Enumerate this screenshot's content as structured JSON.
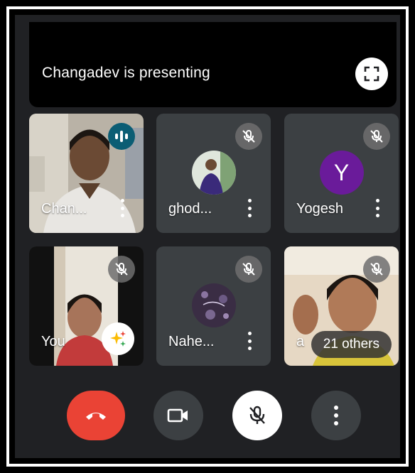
{
  "presentation": {
    "banner_text": "Changadev is presenting",
    "fullscreen_icon": "fullscreen-icon"
  },
  "participants": [
    {
      "name": "Chan...",
      "status": "speaking",
      "video": "camera"
    },
    {
      "name": "ghod...",
      "status": "muted",
      "video": "avatar-photo"
    },
    {
      "name": "Yogesh",
      "status": "muted",
      "video": "avatar-letter",
      "initial": "Y",
      "avatar_color": "#6a1b9a"
    },
    {
      "name": "You",
      "status": "muted",
      "video": "camera"
    },
    {
      "name": "Nahe...",
      "status": "muted",
      "video": "avatar-photo"
    },
    {
      "name": "a",
      "status": "muted",
      "video": "camera",
      "others_label": "21 others"
    }
  ],
  "controls": {
    "end_call_icon": "end-call-icon",
    "camera_icon": "camera-icon",
    "mic_icon": "mic-off-icon",
    "more_icon": "more-vertical-icon"
  },
  "colors": {
    "end_call": "#ea4335",
    "tile_bg": "#3c4043",
    "background": "#202124",
    "speaking": "#0b5d74"
  }
}
